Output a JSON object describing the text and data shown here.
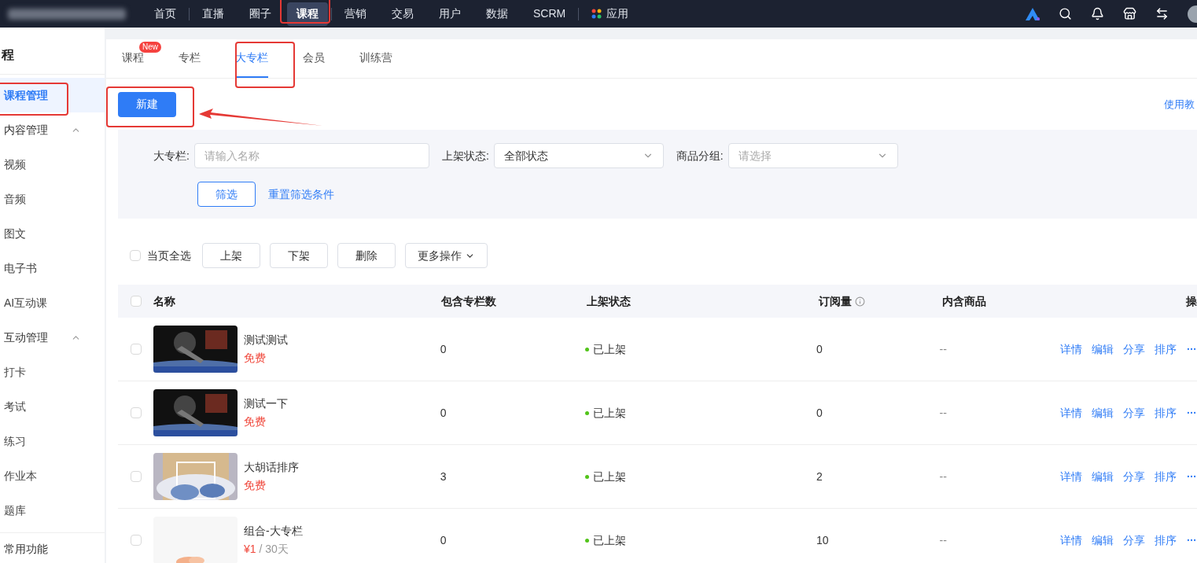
{
  "topnav": {
    "items": [
      {
        "label": "首页",
        "selected": false
      },
      {
        "label": "直播",
        "selected": false
      },
      {
        "label": "圈子",
        "selected": false
      },
      {
        "label": "课程",
        "selected": true
      },
      {
        "label": "营销",
        "selected": false
      },
      {
        "label": "交易",
        "selected": false
      },
      {
        "label": "用户",
        "selected": false
      },
      {
        "label": "数据",
        "selected": false
      },
      {
        "label": "SCRM",
        "selected": false
      },
      {
        "label": "应用",
        "selected": false,
        "kind": "app"
      }
    ]
  },
  "sidebar": {
    "title": "程",
    "items": [
      {
        "label": "课程管理",
        "kind": "item",
        "selected": true
      },
      {
        "label": "内容管理",
        "kind": "group",
        "expanded": true,
        "children": [
          {
            "label": "视频",
            "selected": false
          },
          {
            "label": "音频",
            "selected": false
          },
          {
            "label": "图文",
            "selected": false
          },
          {
            "label": "电子书",
            "selected": false
          },
          {
            "label": "AI互动课",
            "selected": false
          }
        ]
      },
      {
        "label": "互动管理",
        "kind": "group",
        "expanded": true,
        "children": [
          {
            "label": "打卡",
            "selected": false
          },
          {
            "label": "考试",
            "selected": false
          },
          {
            "label": "练习",
            "selected": false
          },
          {
            "label": "作业本",
            "selected": false
          },
          {
            "label": "题库",
            "selected": false
          }
        ]
      },
      {
        "label": "常用功能",
        "kind": "section"
      }
    ]
  },
  "tabs": [
    {
      "label": "课程",
      "selected": false,
      "badge": "New"
    },
    {
      "label": "专栏",
      "selected": false
    },
    {
      "label": "大专栏",
      "selected": true
    },
    {
      "label": "会员",
      "selected": false
    },
    {
      "label": "训练营",
      "selected": false
    }
  ],
  "new_button": "新建",
  "help_link": "使用教",
  "filters": {
    "fields": [
      {
        "label": "大专栏:",
        "kind": "input",
        "placeholder": "请输入名称"
      },
      {
        "label": "上架状态:",
        "kind": "select",
        "value": "全部状态"
      },
      {
        "label": "商品分组:",
        "kind": "select",
        "placeholder": "请选择"
      }
    ],
    "filter_button": "筛选",
    "reset_link": "重置筛选条件"
  },
  "bulk": {
    "select_all": {
      "label": "当页全选",
      "checked": false
    },
    "buttons": [
      "上架",
      "下架",
      "删除"
    ],
    "more": "更多操作"
  },
  "table": {
    "header_checked": false,
    "columns": [
      "名称",
      "包含专栏数",
      "上架状态",
      "订阅量",
      "内含商品",
      "操"
    ],
    "rows": [
      {
        "checked": false,
        "name": "测试测试",
        "price": "免费",
        "count": "0",
        "status": {
          "text": "已上架",
          "color": "#52c41a"
        },
        "subs": "0",
        "goods": "--",
        "actions": [
          "详情",
          "编辑",
          "分享",
          "排序"
        ]
      },
      {
        "checked": false,
        "name": "测试一下",
        "price": "免费",
        "count": "0",
        "status": {
          "text": "已上架",
          "color": "#52c41a"
        },
        "subs": "0",
        "goods": "--",
        "actions": [
          "详情",
          "编辑",
          "分享",
          "排序"
        ]
      },
      {
        "checked": false,
        "name": "大胡话排序",
        "price": "免费",
        "count": "3",
        "status": {
          "text": "已上架",
          "color": "#52c41a"
        },
        "subs": "2",
        "goods": "--",
        "actions": [
          "详情",
          "编辑",
          "分享",
          "排序"
        ]
      },
      {
        "checked": false,
        "name": "组合-大专栏",
        "price": "¥1",
        "period": "/ 30天",
        "count": "0",
        "status": {
          "text": "已上架",
          "color": "#52c41a"
        },
        "subs": "10",
        "goods": "--",
        "actions": [
          "详情",
          "编辑",
          "分享",
          "排序"
        ]
      }
    ]
  }
}
